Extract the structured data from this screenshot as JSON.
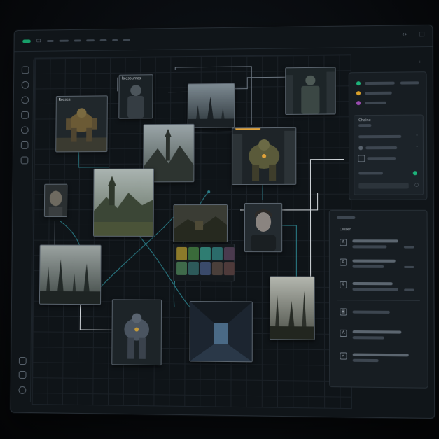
{
  "titlebar": {
    "tab_label": "C1",
    "icons": [
      "collapse-icon",
      "panel-icon"
    ]
  },
  "nodes": [
    {
      "id": "mech-1",
      "caption": "Rosses.",
      "scene": "mech"
    },
    {
      "id": "soldier-1",
      "caption": "Rossoumos",
      "scene": "soldier"
    },
    {
      "id": "city-1",
      "caption": "",
      "scene": "city"
    },
    {
      "id": "knight-1",
      "caption": "",
      "scene": "knight"
    },
    {
      "id": "castle-1",
      "caption": "",
      "scene": "castle"
    },
    {
      "id": "mech-2",
      "caption": "",
      "scene": "mech"
    },
    {
      "id": "face-1",
      "caption": "",
      "scene": "face"
    },
    {
      "id": "landscape-1",
      "caption": "",
      "scene": "landscape"
    },
    {
      "id": "village-1",
      "caption": "",
      "scene": "village"
    },
    {
      "id": "woman-1",
      "caption": "",
      "scene": "woman"
    },
    {
      "id": "city-2",
      "caption": "",
      "scene": "city"
    },
    {
      "id": "mech-3",
      "caption": "",
      "scene": "mech"
    },
    {
      "id": "corridor-1",
      "caption": "",
      "scene": "corridor"
    },
    {
      "id": "city-3",
      "caption": "",
      "scene": "city"
    }
  ],
  "palette": {
    "swatches": [
      "#8c7a2a",
      "#3a6b3a",
      "#2f7d72",
      "#2b6b6a",
      "#4a3a4e",
      "#3f6a4a",
      "#2d5a5a",
      "#3a4a6a",
      "#4a3f3a",
      "#4e3a3a"
    ]
  },
  "right_panel_top": {
    "legend_colors": [
      "#1db37a",
      "#d9a02a",
      "#9a4bb0"
    ],
    "header_label": "Chaine",
    "indicator_color": "#1db37a"
  },
  "right_panel_bottom": {
    "header_label": "Cluser",
    "rows": [
      "font-icon",
      "font-icon",
      "search-icon",
      "crop-icon",
      "font-icon",
      "share-icon"
    ]
  }
}
